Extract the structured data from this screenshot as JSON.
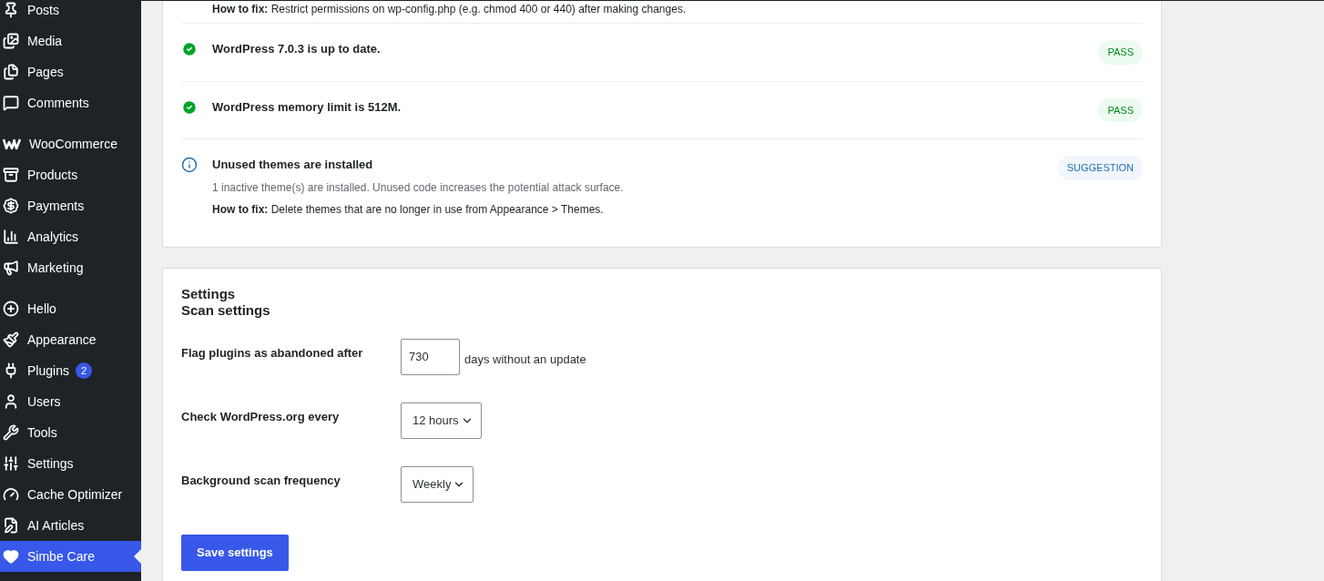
{
  "sidebar": {
    "groups": [
      [
        {
          "label": "Posts",
          "selected": false
        },
        {
          "label": "Media",
          "selected": false
        },
        {
          "label": "Pages",
          "selected": false
        },
        {
          "label": "Comments",
          "selected": false
        }
      ],
      [
        {
          "label": "WooCommerce",
          "selected": false
        },
        {
          "label": "Products",
          "selected": false
        },
        {
          "label": "Payments",
          "selected": false
        },
        {
          "label": "Analytics",
          "selected": false
        },
        {
          "label": "Marketing",
          "selected": false
        }
      ],
      [
        {
          "label": "Hello",
          "selected": false
        },
        {
          "label": "Appearance",
          "selected": false
        },
        {
          "label": "Plugins",
          "selected": false,
          "badge": "2"
        },
        {
          "label": "Users",
          "selected": false
        },
        {
          "label": "Tools",
          "selected": false
        },
        {
          "label": "Settings",
          "selected": false
        },
        {
          "label": "Cache Optimizer",
          "selected": false
        },
        {
          "label": "AI Articles",
          "selected": false
        },
        {
          "label": "Simbe Care",
          "selected": true
        }
      ]
    ]
  },
  "checks": [
    {
      "kind": "partial",
      "fix": "**How to fix:** Restrict permissions on wp-config.php (e.g. chmod 400 or 440) after making changes."
    },
    {
      "kind": "pass",
      "title": "WordPress 7.0.3 is up to date.",
      "badge": "PASS"
    },
    {
      "kind": "pass",
      "title": "WordPress memory limit is 512M.",
      "badge": "PASS"
    },
    {
      "kind": "suggestion",
      "title": "Unused themes are installed",
      "badge": "SUGGESTION",
      "description": "1 inactive theme(s) are installed. Unused code increases the potential attack surface.",
      "fix": "**How to fix:** Delete themes that are no longer in use from Appearance > Themes."
    }
  ],
  "settings": {
    "heading": "Settings",
    "subheading": "Scan settings",
    "fields": [
      {
        "kind": "number",
        "label": "Flag plugins as abandoned after",
        "value": "730",
        "suffix": "days without an update"
      },
      {
        "kind": "select",
        "label": "Check WordPress.org every",
        "value": "12 hours"
      },
      {
        "kind": "select",
        "label": "Background scan frequency",
        "value": "Weekly"
      }
    ],
    "save_button": "Save settings"
  }
}
